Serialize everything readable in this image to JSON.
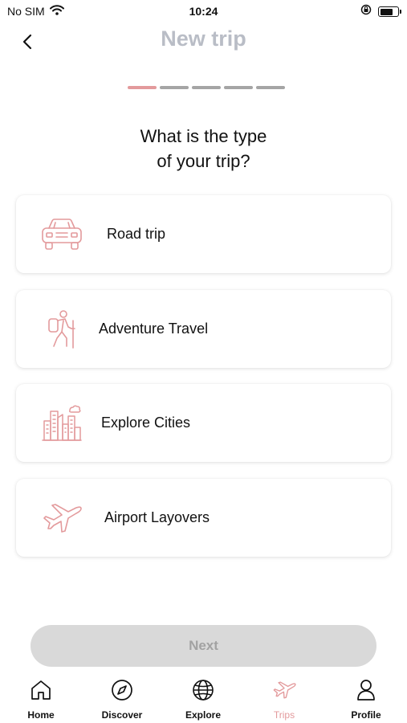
{
  "status_bar": {
    "carrier": "No SIM",
    "time": "10:24",
    "battery_level": 0.75
  },
  "header": {
    "title": "New trip",
    "back_icon": "chevron-left-icon"
  },
  "progress": {
    "total_steps": 5,
    "current_step": 1,
    "accent": "#e39a9c",
    "inactive": "#a5a5a5"
  },
  "question": {
    "line1": "What is the type",
    "line2": "of your trip?"
  },
  "options": [
    {
      "label": "Road trip",
      "icon": "car-icon"
    },
    {
      "label": "Adventure Travel",
      "icon": "hiker-icon"
    },
    {
      "label": "Explore Cities",
      "icon": "city-icon"
    },
    {
      "label": "Airport Layovers",
      "icon": "airplane-icon"
    }
  ],
  "next_button": {
    "label": "Next",
    "disabled": true
  },
  "tabs": [
    {
      "label": "Home",
      "icon": "home-icon",
      "active": false
    },
    {
      "label": "Discover",
      "icon": "compass-icon",
      "active": false
    },
    {
      "label": "Explore",
      "icon": "globe-icon",
      "active": false
    },
    {
      "label": "Trips",
      "icon": "airplane-icon",
      "active": true
    },
    {
      "label": "Profile",
      "icon": "person-icon",
      "active": false
    }
  ],
  "colors": {
    "accent": "#e39a9c",
    "title_gray": "#b9bdc6",
    "button_disabled_bg": "#d9d9d9",
    "button_disabled_text": "#a2a2a2"
  }
}
